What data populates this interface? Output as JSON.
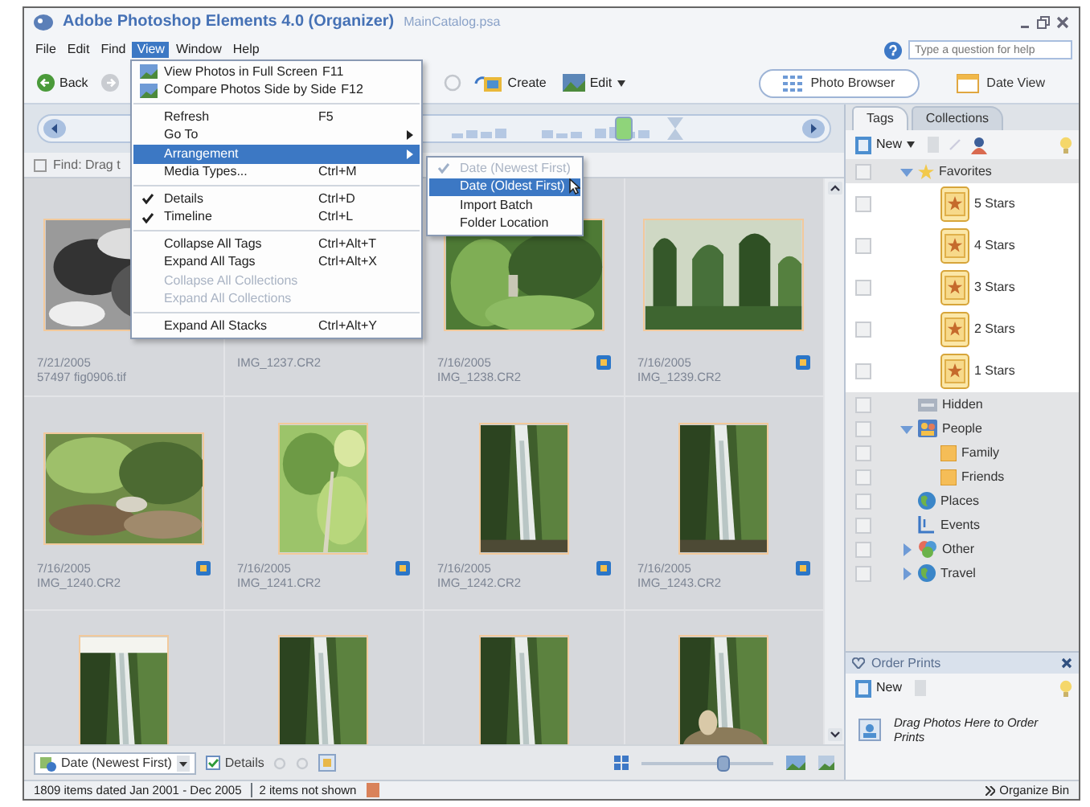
{
  "window": {
    "title": "Adobe Photoshop Elements 4.0 (Organizer)",
    "subtitle": "MainCatalog.psa"
  },
  "menu_bar": [
    {
      "label": "File",
      "selected": false
    },
    {
      "label": "Edit",
      "selected": false
    },
    {
      "label": "Find",
      "selected": false
    },
    {
      "label": "View",
      "selected": true
    },
    {
      "label": "Window",
      "selected": false
    },
    {
      "label": "Help",
      "selected": false
    }
  ],
  "help_search": {
    "placeholder": "Type a question for help"
  },
  "toolbar": {
    "back": "Back",
    "create": "Create",
    "edit": "Edit"
  },
  "view_tabs": [
    {
      "label": "Photo Browser",
      "selected": true
    },
    {
      "label": "Date View",
      "selected": false
    }
  ],
  "find_bar": "Find: Drag t",
  "photos": [
    {
      "date": "7/21/2005",
      "filename": "57497 fig0906.tif",
      "badge": false
    },
    {
      "filename": "IMG_1237.CR2",
      "badge": false
    },
    {
      "date": "7/16/2005",
      "filename": "IMG_1238.CR2",
      "badge": true
    },
    {
      "date": "7/16/2005",
      "filename": "IMG_1239.CR2",
      "badge": true
    },
    {
      "date": "7/16/2005",
      "filename": "IMG_1240.CR2",
      "badge": true
    },
    {
      "date": "7/16/2005",
      "filename": "IMG_1241.CR2",
      "badge": true
    },
    {
      "date": "7/16/2005",
      "filename": "IMG_1242.CR2",
      "badge": true
    },
    {
      "date": "7/16/2005",
      "filename": "IMG_1243.CR2",
      "badge": true
    },
    {
      "badge": false
    },
    {
      "badge": false
    },
    {
      "badge": false
    },
    {
      "badge": false
    }
  ],
  "view_menu": [
    {
      "label": "View Photos in Full Screen",
      "shortcut": "F11",
      "kind": "icon",
      "separator_before": false,
      "checked": false,
      "disabled": false,
      "selected": false,
      "submenu": false
    },
    {
      "label": "Compare Photos Side by Side",
      "shortcut": "F12",
      "kind": "icon",
      "separator_before": false,
      "checked": false,
      "disabled": false,
      "selected": false,
      "submenu": false
    },
    {
      "label": "Refresh",
      "shortcut": "F5",
      "kind": "plain",
      "separator_before": true,
      "checked": false,
      "disabled": false,
      "selected": false,
      "submenu": false
    },
    {
      "label": "Go To",
      "kind": "plain",
      "separator_before": false,
      "checked": false,
      "disabled": false,
      "selected": false,
      "submenu": true
    },
    {
      "label": "Arrangement",
      "kind": "plain",
      "separator_before": false,
      "checked": false,
      "disabled": false,
      "selected": true,
      "submenu": true
    },
    {
      "label": "Media Types...",
      "shortcut": "Ctrl+M",
      "kind": "plain",
      "separator_before": false,
      "checked": false,
      "disabled": false,
      "selected": false,
      "submenu": false
    },
    {
      "label": "Details",
      "shortcut": "Ctrl+D",
      "kind": "plain",
      "separator_before": true,
      "checked": true,
      "disabled": false,
      "selected": false,
      "submenu": false
    },
    {
      "label": "Timeline",
      "shortcut": "Ctrl+L",
      "kind": "plain",
      "separator_before": false,
      "checked": true,
      "disabled": false,
      "selected": false,
      "submenu": false
    },
    {
      "label": "Collapse All Tags",
      "shortcut": "Ctrl+Alt+T",
      "kind": "plain",
      "separator_before": true,
      "checked": false,
      "disabled": false,
      "selected": false,
      "submenu": false
    },
    {
      "label": "Expand All Tags",
      "shortcut": "Ctrl+Alt+X",
      "kind": "plain",
      "separator_before": false,
      "checked": false,
      "disabled": false,
      "selected": false,
      "submenu": false
    },
    {
      "label": "Collapse All Collections",
      "kind": "plain",
      "separator_before": false,
      "checked": false,
      "disabled": true,
      "selected": false,
      "submenu": false
    },
    {
      "label": "Expand All Collections",
      "kind": "plain",
      "separator_before": false,
      "checked": false,
      "disabled": true,
      "selected": false,
      "submenu": false
    },
    {
      "label": "Expand All Stacks",
      "shortcut": "Ctrl+Alt+Y",
      "kind": "plain",
      "separator_before": true,
      "checked": false,
      "disabled": false,
      "selected": false,
      "submenu": false
    }
  ],
  "arrangement_submenu": [
    {
      "label": "Date (Newest First)",
      "checked": true,
      "disabled": true,
      "selected": false
    },
    {
      "label": "Date (Oldest First)",
      "checked": false,
      "disabled": false,
      "selected": true
    },
    {
      "label": "Import Batch",
      "checked": false,
      "disabled": false,
      "selected": false
    },
    {
      "label": "Folder Location",
      "checked": false,
      "disabled": false,
      "selected": false
    }
  ],
  "panel_tabs": [
    {
      "label": "Tags",
      "selected": true
    },
    {
      "label": "Collections",
      "selected": false
    }
  ],
  "tag_toolbar": {
    "new": "New"
  },
  "tags": [
    {
      "label": "Favorites",
      "kind": "favorites",
      "checked": false,
      "expanded": true,
      "children": [
        {
          "label": "5 Stars",
          "kind": "rating",
          "checked": false
        },
        {
          "label": "4 Stars",
          "kind": "rating",
          "checked": false
        },
        {
          "label": "3 Stars",
          "kind": "rating",
          "checked": false
        },
        {
          "label": "2 Stars",
          "kind": "rating",
          "checked": false
        },
        {
          "label": "1 Stars",
          "kind": "rating",
          "checked": false
        }
      ]
    },
    {
      "label": "Hidden",
      "kind": "hidden",
      "checked": false
    },
    {
      "label": "People",
      "kind": "people",
      "checked": false,
      "expanded": true,
      "children": [
        {
          "label": "Family",
          "kind": "tag",
          "checked": false
        },
        {
          "label": "Friends",
          "kind": "tag",
          "checked": false
        }
      ]
    },
    {
      "label": "Places",
      "kind": "places",
      "checked": false
    },
    {
      "label": "Events",
      "kind": "events",
      "checked": false
    },
    {
      "label": "Other",
      "kind": "other",
      "checked": false,
      "expanded": false
    },
    {
      "label": "Travel",
      "kind": "places",
      "checked": false,
      "expanded": false
    }
  ],
  "order_prints": {
    "title": "Order Prints",
    "new": "New",
    "hint": "Drag Photos Here to Order Prints"
  },
  "bottom_bar": {
    "sort": "Date (Newest First)",
    "details": {
      "label": "Details",
      "checked": true
    },
    "zoom": {
      "level": 0.62
    }
  },
  "status_bar": {
    "items_text": "1809 items dated Jan 2001 - Dec 2005",
    "hidden_text": "2 items not shown",
    "organize_bin": "Organize Bin"
  }
}
